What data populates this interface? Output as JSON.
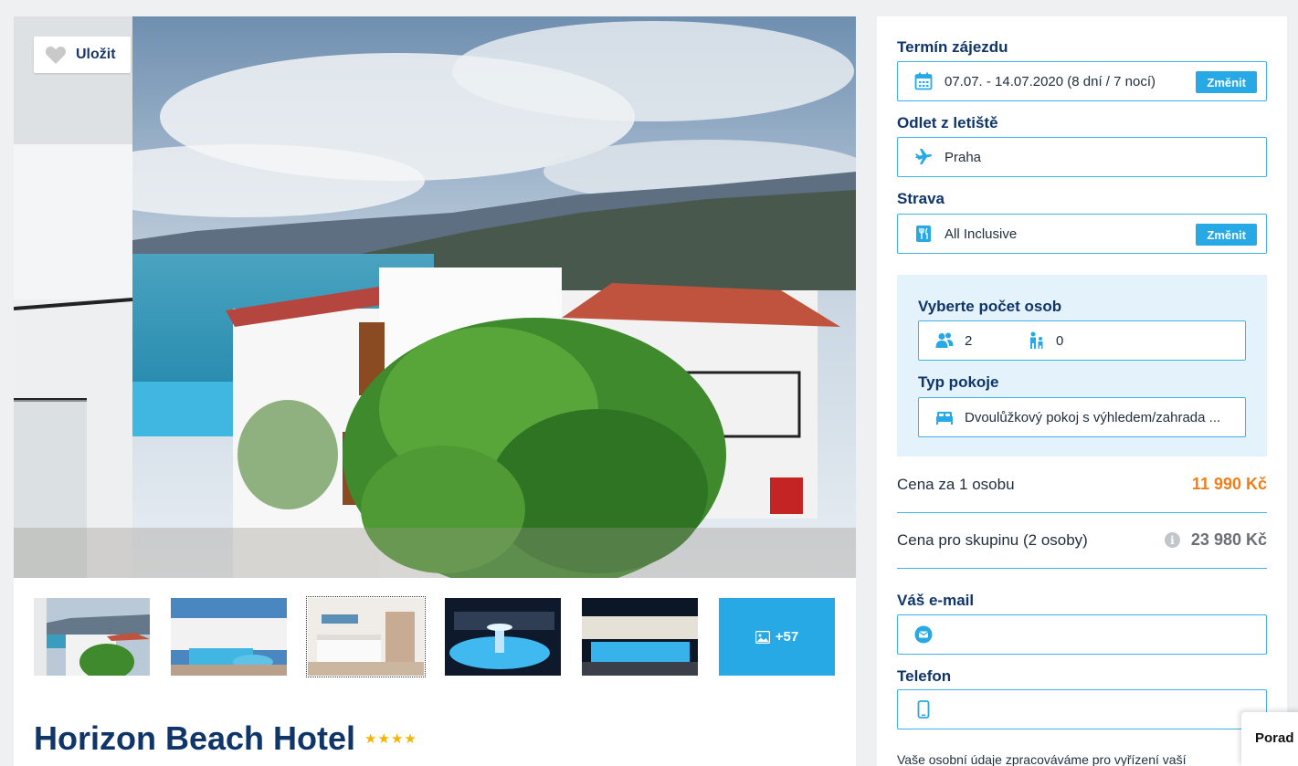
{
  "hero": {
    "save_label": "Uložit",
    "alt": "Hotel view"
  },
  "thumbnails": {
    "more_label": "+57"
  },
  "hotel": {
    "name": "Horizon Beach Hotel",
    "stars": "★★★★",
    "star_count": 4
  },
  "booking": {
    "term_label": "Termín zájezdu",
    "term_value": "07.07. - 14.07.2020 (8 dní / 7 nocí)",
    "change_label": "Změnit",
    "airport_label": "Odlet z letiště",
    "airport_value": "Praha",
    "board_label": "Strava",
    "board_value": "All Inclusive",
    "persons_label": "Vyberte počet osob",
    "adults": "2",
    "children": "0",
    "room_label": "Typ pokoje",
    "room_value": "Dvoulůžkový pokoj s výhledem/zahrada ...",
    "price_per_person_label": "Cena za 1 osobu",
    "price_per_person": "11 990 Kč",
    "price_group_label": "Cena pro skupinu (2 osoby)",
    "price_group": "23 980 Kč",
    "info_icon": "i",
    "email_label": "Váš e-mail",
    "phone_label": "Telefon",
    "privacy_note": "Vaše osobní údaje zpracováváme pro vyřízení vaší"
  },
  "chat": {
    "label": "Porad"
  },
  "colors": {
    "accent": "#26a9e5",
    "title": "#0f3569",
    "price": "#ef7f1a",
    "box_bg": "#e4f3fb"
  }
}
